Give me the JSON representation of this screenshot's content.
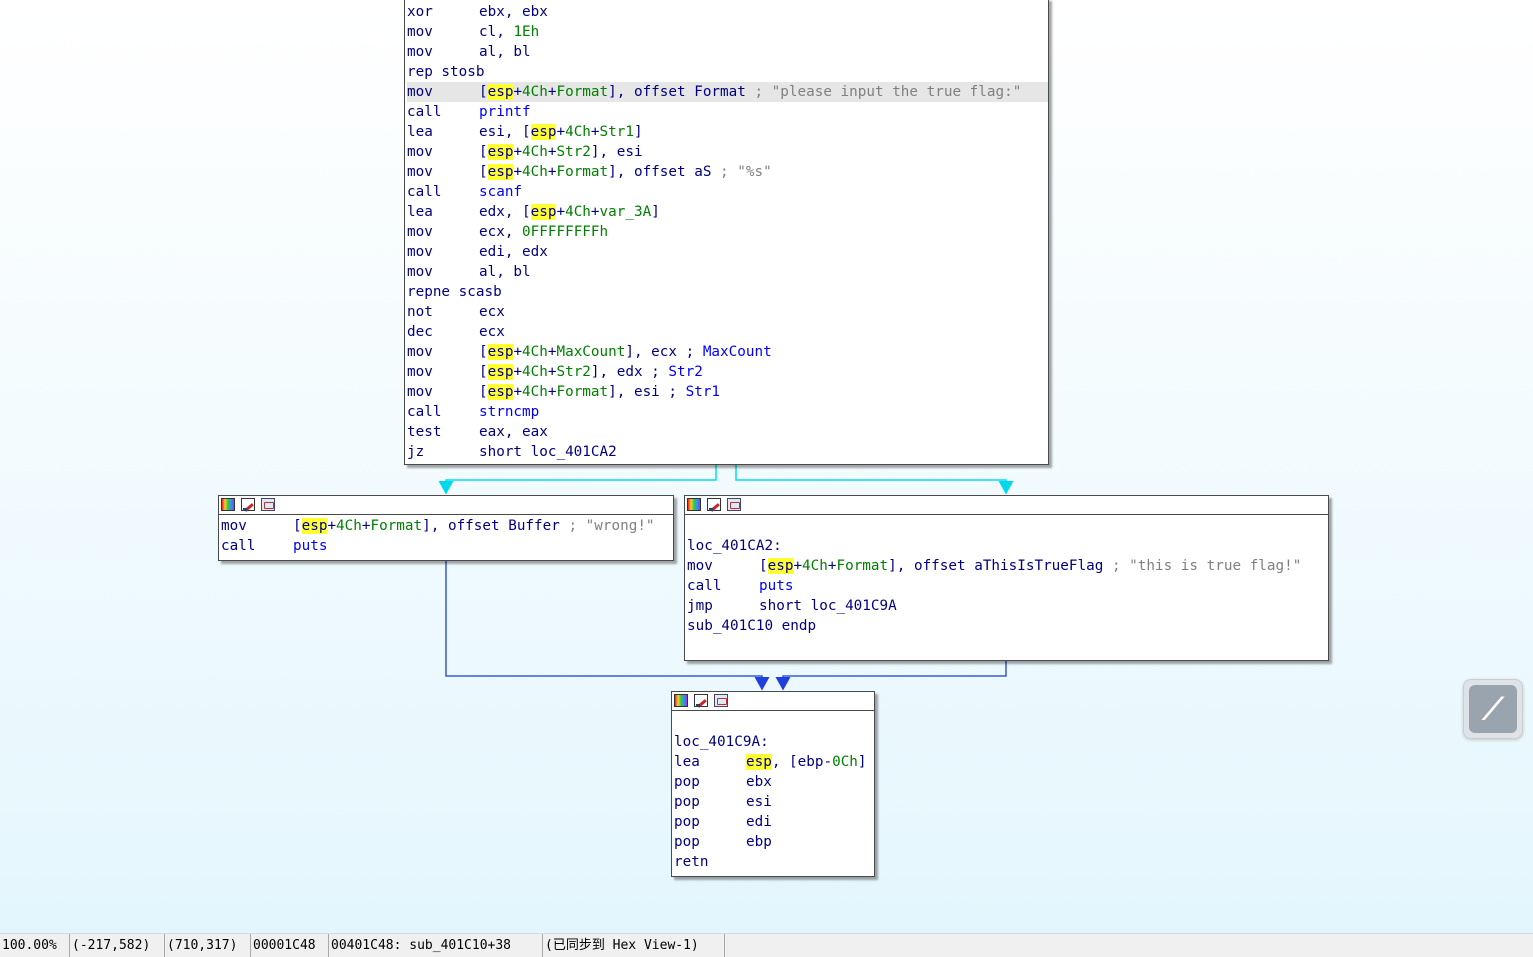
{
  "main_block": {
    "lines": [
      {
        "m": "xor",
        "ops": [
          {
            "t": "reg",
            "v": "ebx, ebx"
          }
        ]
      },
      {
        "m": "mov",
        "ops": [
          {
            "t": "reg",
            "v": "cl, "
          },
          {
            "t": "num",
            "v": "1Eh"
          }
        ]
      },
      {
        "m": "mov",
        "ops": [
          {
            "t": "reg",
            "v": "al, bl"
          }
        ]
      },
      {
        "m": "rep stosb",
        "ops": []
      },
      {
        "m": "mov",
        "sel": true,
        "ops": [
          {
            "t": "reg",
            "v": "["
          },
          {
            "t": "hl",
            "v": "esp"
          },
          {
            "t": "reg",
            "v": "+"
          },
          {
            "t": "nm",
            "v": "4Ch"
          },
          {
            "t": "reg",
            "v": "+"
          },
          {
            "t": "nm",
            "v": "Format"
          },
          {
            "t": "reg",
            "v": "], offset Format "
          },
          {
            "t": "cmt",
            "v": "; \"please input the true flag:\""
          }
        ]
      },
      {
        "m": "call",
        "ops": [
          {
            "t": "fn",
            "v": "printf"
          }
        ]
      },
      {
        "m": "lea",
        "ops": [
          {
            "t": "reg",
            "v": "esi, ["
          },
          {
            "t": "hl",
            "v": "esp"
          },
          {
            "t": "reg",
            "v": "+"
          },
          {
            "t": "nm",
            "v": "4Ch"
          },
          {
            "t": "reg",
            "v": "+"
          },
          {
            "t": "nm",
            "v": "Str1"
          },
          {
            "t": "reg",
            "v": "]"
          }
        ]
      },
      {
        "m": "mov",
        "ops": [
          {
            "t": "reg",
            "v": "["
          },
          {
            "t": "hl",
            "v": "esp"
          },
          {
            "t": "reg",
            "v": "+"
          },
          {
            "t": "nm",
            "v": "4Ch"
          },
          {
            "t": "reg",
            "v": "+"
          },
          {
            "t": "nm",
            "v": "Str2"
          },
          {
            "t": "reg",
            "v": "], esi"
          }
        ]
      },
      {
        "m": "mov",
        "ops": [
          {
            "t": "reg",
            "v": "["
          },
          {
            "t": "hl",
            "v": "esp"
          },
          {
            "t": "reg",
            "v": "+"
          },
          {
            "t": "nm",
            "v": "4Ch"
          },
          {
            "t": "reg",
            "v": "+"
          },
          {
            "t": "nm",
            "v": "Format"
          },
          {
            "t": "reg",
            "v": "], offset aS "
          },
          {
            "t": "cmt",
            "v": "; \"%s\""
          }
        ]
      },
      {
        "m": "call",
        "ops": [
          {
            "t": "fn",
            "v": "scanf"
          }
        ]
      },
      {
        "m": "lea",
        "ops": [
          {
            "t": "reg",
            "v": "edx, ["
          },
          {
            "t": "hl",
            "v": "esp"
          },
          {
            "t": "reg",
            "v": "+"
          },
          {
            "t": "nm",
            "v": "4Ch"
          },
          {
            "t": "reg",
            "v": "+"
          },
          {
            "t": "nm",
            "v": "var_3A"
          },
          {
            "t": "reg",
            "v": "]"
          }
        ]
      },
      {
        "m": "mov",
        "ops": [
          {
            "t": "reg",
            "v": "ecx, "
          },
          {
            "t": "num",
            "v": "0FFFFFFFFh"
          }
        ]
      },
      {
        "m": "mov",
        "ops": [
          {
            "t": "reg",
            "v": "edi, edx"
          }
        ]
      },
      {
        "m": "mov",
        "ops": [
          {
            "t": "reg",
            "v": "al, bl"
          }
        ]
      },
      {
        "m": "repne scasb",
        "ops": []
      },
      {
        "m": "not",
        "ops": [
          {
            "t": "reg",
            "v": "ecx"
          }
        ]
      },
      {
        "m": "dec",
        "ops": [
          {
            "t": "reg",
            "v": "ecx"
          }
        ]
      },
      {
        "m": "mov",
        "ops": [
          {
            "t": "reg",
            "v": "["
          },
          {
            "t": "hl",
            "v": "esp"
          },
          {
            "t": "reg",
            "v": "+"
          },
          {
            "t": "nm",
            "v": "4Ch"
          },
          {
            "t": "reg",
            "v": "+"
          },
          {
            "t": "nm",
            "v": "MaxCount"
          },
          {
            "t": "reg",
            "v": "], ecx ; "
          },
          {
            "t": "fn",
            "v": "MaxCount"
          }
        ]
      },
      {
        "m": "mov",
        "ops": [
          {
            "t": "reg",
            "v": "["
          },
          {
            "t": "hl",
            "v": "esp"
          },
          {
            "t": "reg",
            "v": "+"
          },
          {
            "t": "nm",
            "v": "4Ch"
          },
          {
            "t": "reg",
            "v": "+"
          },
          {
            "t": "nm",
            "v": "Str2"
          },
          {
            "t": "reg",
            "v": "], edx ; "
          },
          {
            "t": "fn",
            "v": "Str2"
          }
        ]
      },
      {
        "m": "mov",
        "ops": [
          {
            "t": "reg",
            "v": "["
          },
          {
            "t": "hl",
            "v": "esp"
          },
          {
            "t": "reg",
            "v": "+"
          },
          {
            "t": "nm",
            "v": "4Ch"
          },
          {
            "t": "reg",
            "v": "+"
          },
          {
            "t": "nm",
            "v": "Format"
          },
          {
            "t": "reg",
            "v": "], esi ; "
          },
          {
            "t": "fn",
            "v": "Str1"
          }
        ]
      },
      {
        "m": "call",
        "ops": [
          {
            "t": "fn",
            "v": "strncmp"
          }
        ]
      },
      {
        "m": "test",
        "ops": [
          {
            "t": "reg",
            "v": "eax, eax"
          }
        ]
      },
      {
        "m": "jz",
        "ops": [
          {
            "t": "reg",
            "v": "short loc_401CA2"
          }
        ]
      }
    ]
  },
  "wrong_block": {
    "lines": [
      {
        "m": "mov",
        "ops": [
          {
            "t": "reg",
            "v": "["
          },
          {
            "t": "hl",
            "v": "esp"
          },
          {
            "t": "reg",
            "v": "+"
          },
          {
            "t": "nm",
            "v": "4Ch"
          },
          {
            "t": "reg",
            "v": "+"
          },
          {
            "t": "nm",
            "v": "Format"
          },
          {
            "t": "reg",
            "v": "], offset Buffer "
          },
          {
            "t": "cmt",
            "v": "; \"wrong!\""
          }
        ]
      },
      {
        "m": "call",
        "ops": [
          {
            "t": "fn",
            "v": "puts"
          }
        ]
      }
    ]
  },
  "true_block": {
    "lines": [
      {
        "m": "",
        "ops": []
      },
      {
        "label": "loc_401CA2:"
      },
      {
        "m": "mov",
        "ops": [
          {
            "t": "reg",
            "v": "["
          },
          {
            "t": "hl",
            "v": "esp"
          },
          {
            "t": "reg",
            "v": "+"
          },
          {
            "t": "nm",
            "v": "4Ch"
          },
          {
            "t": "reg",
            "v": "+"
          },
          {
            "t": "nm",
            "v": "Format"
          },
          {
            "t": "reg",
            "v": "], offset aThisIsTrueFlag "
          },
          {
            "t": "cmt",
            "v": "; \"this is true flag!\""
          }
        ]
      },
      {
        "m": "call",
        "ops": [
          {
            "t": "fn",
            "v": "puts"
          }
        ]
      },
      {
        "m": "jmp",
        "ops": [
          {
            "t": "reg",
            "v": "short loc_401C9A"
          }
        ]
      },
      {
        "label": "sub_401C10 endp"
      }
    ]
  },
  "end_block": {
    "lines": [
      {
        "m": "",
        "ops": []
      },
      {
        "label": "loc_401C9A:"
      },
      {
        "m": "lea",
        "ops": [
          {
            "t": "hl",
            "v": "esp"
          },
          {
            "t": "reg",
            "v": ", [ebp-"
          },
          {
            "t": "num",
            "v": "0Ch"
          },
          {
            "t": "reg",
            "v": "]"
          }
        ]
      },
      {
        "m": "pop",
        "ops": [
          {
            "t": "reg",
            "v": "ebx"
          }
        ]
      },
      {
        "m": "pop",
        "ops": [
          {
            "t": "reg",
            "v": "esi"
          }
        ]
      },
      {
        "m": "pop",
        "ops": [
          {
            "t": "reg",
            "v": "edi"
          }
        ]
      },
      {
        "m": "pop",
        "ops": [
          {
            "t": "reg",
            "v": "ebp"
          }
        ]
      },
      {
        "m": "retn",
        "ops": []
      }
    ]
  },
  "node_header_icons": [
    "color-palette-icon",
    "edit-pencil-icon",
    "graph-view-icon"
  ],
  "statusbar": {
    "zoom": "100.00%",
    "graph_coords": "(-217,582)",
    "mouse_coords": "(710,317)",
    "file_offset": "00001C48",
    "address": "00401C48: sub_401C10+38",
    "sync": "(已同步到 Hex View-1)"
  },
  "colors": {
    "edge_branch": "#00e0f0",
    "edge_flow": "#3a5ad0",
    "highlight": "#ffff32"
  }
}
